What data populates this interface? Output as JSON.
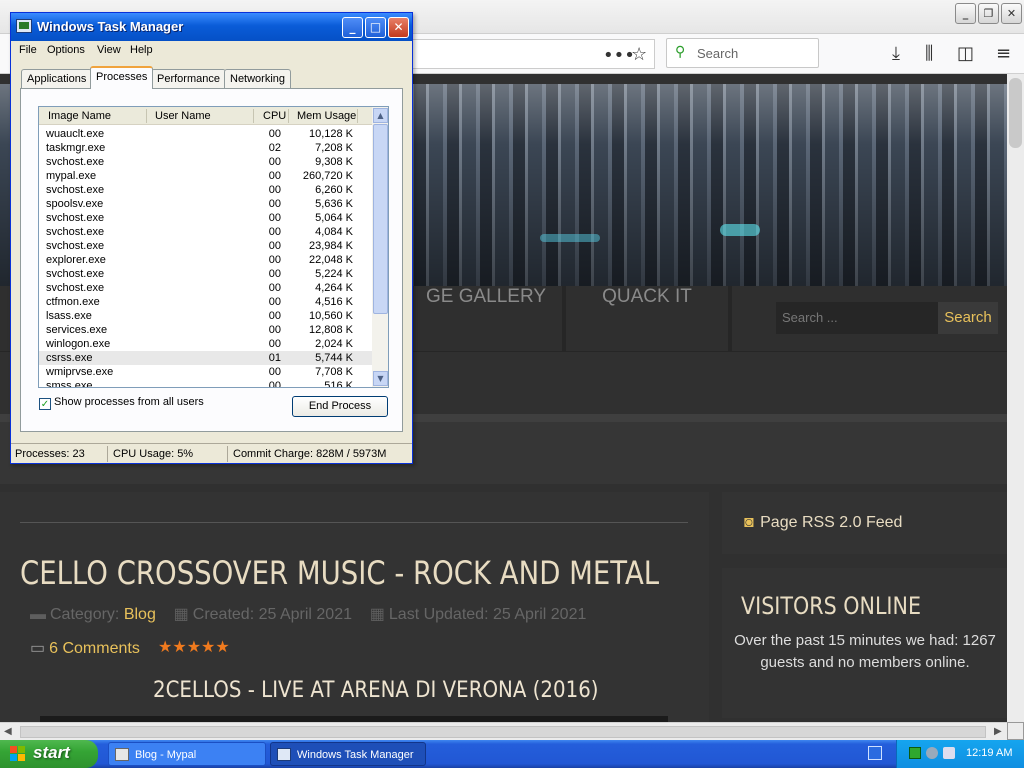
{
  "browser": {
    "search_placeholder": "Search",
    "toolbar_icons": [
      "more-icon",
      "bookmark-star-icon",
      "download-icon",
      "library-icon",
      "sidebar-icon",
      "menu-icon"
    ]
  },
  "site": {
    "nav": [
      "GE GALLERY",
      "QUACK IT"
    ],
    "search_placeholder": "Search ...",
    "search_button": "Search",
    "article": {
      "title": "CELLO CROSSOVER MUSIC - ROCK AND METAL",
      "category_label": "Category:",
      "category": "Blog",
      "created": "Created: 25 April 2021",
      "updated": "Last Updated: 25 April 2021",
      "comments": "6 Comments",
      "rating": 5,
      "subheading": "2CELLOS - LIVE AT ARENA DI VERONA (2016)"
    },
    "sidebar": {
      "rss": "Page RSS 2.0 Feed",
      "visitors_title": "VISITORS ONLINE",
      "visitors_text": "Over the past 15 minutes we had: 1267 guests and no members online."
    },
    "colors": {
      "accent": "#e8c15b",
      "background": "#303030",
      "star": "#f07a1e"
    }
  },
  "taskmgr": {
    "title": "Windows Task Manager",
    "menu": [
      "File",
      "Options",
      "View",
      "Help"
    ],
    "tabs": [
      "Applications",
      "Processes",
      "Performance",
      "Networking"
    ],
    "active_tab": "Processes",
    "columns": [
      "Image Name",
      "User Name",
      "CPU",
      "Mem Usage"
    ],
    "processes": [
      {
        "name": "wuauclt.exe",
        "cpu": "00",
        "mem": "10,128 K"
      },
      {
        "name": "taskmgr.exe",
        "cpu": "02",
        "mem": "7,208 K"
      },
      {
        "name": "svchost.exe",
        "cpu": "00",
        "mem": "9,308 K"
      },
      {
        "name": "mypal.exe",
        "cpu": "00",
        "mem": "260,720 K"
      },
      {
        "name": "svchost.exe",
        "cpu": "00",
        "mem": "6,260 K"
      },
      {
        "name": "spoolsv.exe",
        "cpu": "00",
        "mem": "5,636 K"
      },
      {
        "name": "svchost.exe",
        "cpu": "00",
        "mem": "5,064 K"
      },
      {
        "name": "svchost.exe",
        "cpu": "00",
        "mem": "4,084 K"
      },
      {
        "name": "svchost.exe",
        "cpu": "00",
        "mem": "23,984 K"
      },
      {
        "name": "explorer.exe",
        "cpu": "00",
        "mem": "22,048 K"
      },
      {
        "name": "svchost.exe",
        "cpu": "00",
        "mem": "5,224 K"
      },
      {
        "name": "svchost.exe",
        "cpu": "00",
        "mem": "4,264 K"
      },
      {
        "name": "ctfmon.exe",
        "cpu": "00",
        "mem": "4,516 K"
      },
      {
        "name": "lsass.exe",
        "cpu": "00",
        "mem": "10,560 K"
      },
      {
        "name": "services.exe",
        "cpu": "00",
        "mem": "12,808 K"
      },
      {
        "name": "winlogon.exe",
        "cpu": "00",
        "mem": "2,024 K"
      },
      {
        "name": "csrss.exe",
        "cpu": "01",
        "mem": "5,744 K",
        "selected": true
      },
      {
        "name": "wmiprvse.exe",
        "cpu": "00",
        "mem": "7,708 K"
      },
      {
        "name": "smss.exe",
        "cpu": "00",
        "mem": "516 K"
      }
    ],
    "show_all_label": "Show processes from all users",
    "show_all_checked": true,
    "end_process": "End Process",
    "status": {
      "processes": "Processes: 23",
      "cpu": "CPU Usage: 5%",
      "commit": "Commit Charge: 828M / 5973M"
    }
  },
  "taskbar": {
    "start": "start",
    "tasks": [
      {
        "label": "Blog - Mypal",
        "active": false
      },
      {
        "label": "Windows Task Manager",
        "active": true
      }
    ],
    "clock": "12:19 AM"
  }
}
